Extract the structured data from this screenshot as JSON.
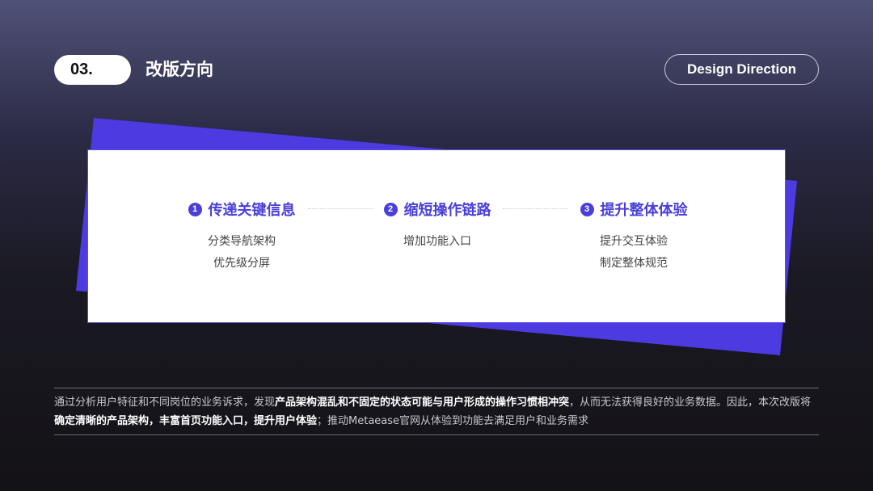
{
  "header": {
    "section_number": "03.",
    "section_title": "改版方向",
    "tag": "Design Direction"
  },
  "colors": {
    "accent": "#4a3fd9",
    "background_top": "#4f5177",
    "background_bottom": "#131216"
  },
  "card": {
    "columns": [
      {
        "number": "1",
        "title": "传递关键信息",
        "items": [
          "分类导航架构",
          "优先级分屏"
        ]
      },
      {
        "number": "2",
        "title": "缩短操作链路",
        "items": [
          "增加功能入口"
        ]
      },
      {
        "number": "3",
        "title": "提升整体体验",
        "items": [
          "提升交互体验",
          "制定整体规范"
        ]
      }
    ]
  },
  "summary": {
    "p1": "通过分析用户特征和不同岗位的业务诉求，发现",
    "b1": "产品架构混乱和不固定的状态可能与用户形成的操作习惯相冲突",
    "p2": "，从而无法获得良好的业务数据。因此，本次改版将",
    "b2": "确定清晰的产品架构，丰富首页功能入口，提升用户体验",
    "p3": "；推动Metaease官网从体验到功能去满足用户和业务需求"
  }
}
